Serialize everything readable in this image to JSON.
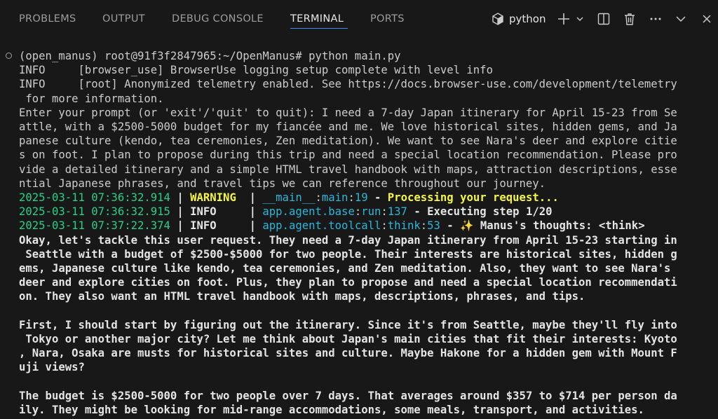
{
  "panel": {
    "tabs": [
      "PROBLEMS",
      "OUTPUT",
      "DEBUG CONSOLE",
      "TERMINAL",
      "PORTS"
    ],
    "active_tab": "TERMINAL",
    "shell": "python"
  },
  "terminal": {
    "lines": [
      "(open_manus) root@91f3f2847965:~/OpenManus# python main.py",
      "INFO     [browser_use] BrowserUse logging setup complete with level info",
      "INFO     [root] Anonymized telemetry enabled. See https://docs.browser-use.com/development/telemetry",
      " for more information.",
      "Enter your prompt (or 'exit'/'quit' to quit): I need a 7-day Japan itinerary for April 15-23 from Se",
      "attle, with a $2500-5000 budget for my fiancée and me. We love historical sites, hidden gems, and Ja",
      "panese culture (kendo, tea ceremonies, Zen meditation). We want to see Nara's deer and explore citie",
      "s on foot. I plan to propose during this trip and need a special location recommendation. Please pro",
      "vide a detailed itinerary and a simple HTML travel handbook with maps, attraction descriptions, esse",
      "ntial Japanese phrases, and travel tips we can reference throughout our journey."
    ],
    "log_lines": [
      {
        "ts": "2025-03-11 07:36:32.914",
        "sep1": " | ",
        "level": "WARNING ",
        "sep2": " | ",
        "mod": "__main__",
        "c1": ":",
        "func": "main",
        "c2": ":",
        "lineno": "19",
        "dash": " - ",
        "msg": "Processing your request..."
      },
      {
        "ts": "2025-03-11 07:36:32.915",
        "sep1": " | ",
        "level": "INFO    ",
        "sep2": " | ",
        "mod": "app.agent.base",
        "c1": ":",
        "func": "run",
        "c2": ":",
        "lineno": "137",
        "dash": " - ",
        "msg": "Executing step 1/20"
      },
      {
        "ts": "2025-03-11 07:37:22.374",
        "sep1": " | ",
        "level": "INFO    ",
        "sep2": " | ",
        "mod": "app.agent.toolcall",
        "c1": ":",
        "func": "think",
        "c2": ":",
        "lineno": "53",
        "dash": " - ",
        "msg": "✨ Manus's thoughts: <think>"
      }
    ],
    "thoughts": [
      "Okay, let's tackle this user request. They need a 7-day Japan itinerary from April 15-23 starting in",
      " Seattle with a budget of $2500-$5000 for two people. Their interests are historical sites, hidden g",
      "ems, Japanese culture like kendo, tea ceremonies, and Zen meditation. Also, they want to see Nara's",
      "deer and explore cities on foot. Plus, they plan to propose and need a special location recommendati",
      "on. They also want an HTML travel handbook with maps, descriptions, phrases, and tips.",
      "",
      "First, I should start by figuring out the itinerary. Since it's from Seattle, maybe they'll fly into",
      " Tokyo or another major city? Let me think about Japan's main cities that fit their interests: Kyoto",
      ", Nara, Osaka are musts for historical sites and culture. Maybe Hakone for a hidden gem with Mount F",
      "uji views?",
      "",
      "The budget is $2500-5000 for two people over 7 days. That averages around $357 to $714 per person da",
      "ily. They might be looking for mid-range accommodations, some meals, transport, and activities."
    ]
  }
}
